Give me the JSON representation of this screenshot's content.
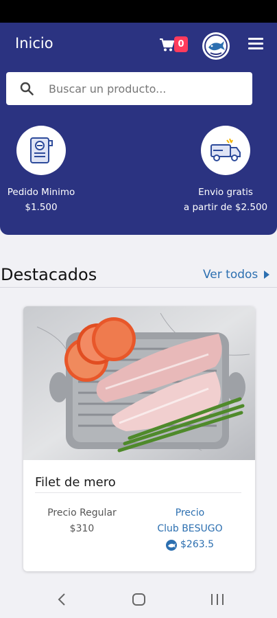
{
  "header": {
    "title": "Inicio",
    "cart_count": "0",
    "search_placeholder": "Buscar un producto..."
  },
  "info": {
    "minimum": {
      "label": "Pedido Minimo",
      "value": "$1.500",
      "icon": "form-icon"
    },
    "shipping": {
      "label": "Envio gratis",
      "value": "a partir de $2.500",
      "icon": "delivery-truck-icon"
    }
  },
  "featured": {
    "title": "Destacados",
    "see_all": "Ver todos"
  },
  "product": {
    "name": "Filet de mero",
    "regular_label": "Precio Regular",
    "regular_price": "$310",
    "club_label_1": "Precio",
    "club_label_2": "Club BESUGO",
    "club_price": "$263.5",
    "image": "fish-fillet-photo"
  },
  "colors": {
    "header_bg": "#2b3381",
    "accent": "#2c6fb0",
    "badge": "#ff3b5c"
  }
}
